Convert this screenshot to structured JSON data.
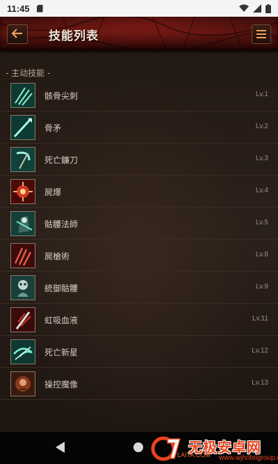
{
  "status_bar": {
    "time": "11:45",
    "icons": [
      "sd-card-icon",
      "wifi-icon",
      "signal-icon",
      "battery-icon"
    ]
  },
  "header": {
    "title": "技能列表",
    "back_icon": "back-arrow-icon",
    "menu_icon": "hamburger-menu-icon"
  },
  "section": {
    "title": "- 主动技能 -"
  },
  "skills": [
    {
      "name": "骸骨尖刺",
      "level": "Lv.1",
      "icon": "bone-spikes-icon"
    },
    {
      "name": "骨矛",
      "level": "Lv.2",
      "icon": "bone-spear-icon"
    },
    {
      "name": "死亡鐮刀",
      "level": "Lv.3",
      "icon": "death-scythe-icon"
    },
    {
      "name": "屍爆",
      "level": "Lv.4",
      "icon": "corpse-explosion-icon"
    },
    {
      "name": "骷髏法師",
      "level": "Lv.5",
      "icon": "skeletal-mage-icon"
    },
    {
      "name": "屍槍術",
      "level": "Lv.8",
      "icon": "corpse-lance-icon"
    },
    {
      "name": "統御骷髏",
      "level": "Lv.9",
      "icon": "command-skeletons-icon"
    },
    {
      "name": "虹吸血液",
      "level": "Lv.11",
      "icon": "siphon-blood-icon"
    },
    {
      "name": "死亡新星",
      "level": "Lv.12",
      "icon": "death-nova-icon"
    },
    {
      "name": "操控魔像",
      "level": "Lv.13",
      "icon": "command-golem-icon"
    }
  ],
  "nav_bar": {
    "watermark_text": "无极安卓网",
    "watermark_sub": "LAITA.COM",
    "watermark_url": "www.wjhotelgroup.com"
  },
  "colors": {
    "header_red": "#5a1410",
    "accent_orange": "#e7a35e",
    "background": "#241a14",
    "watermark_orange": "#e8441e"
  }
}
